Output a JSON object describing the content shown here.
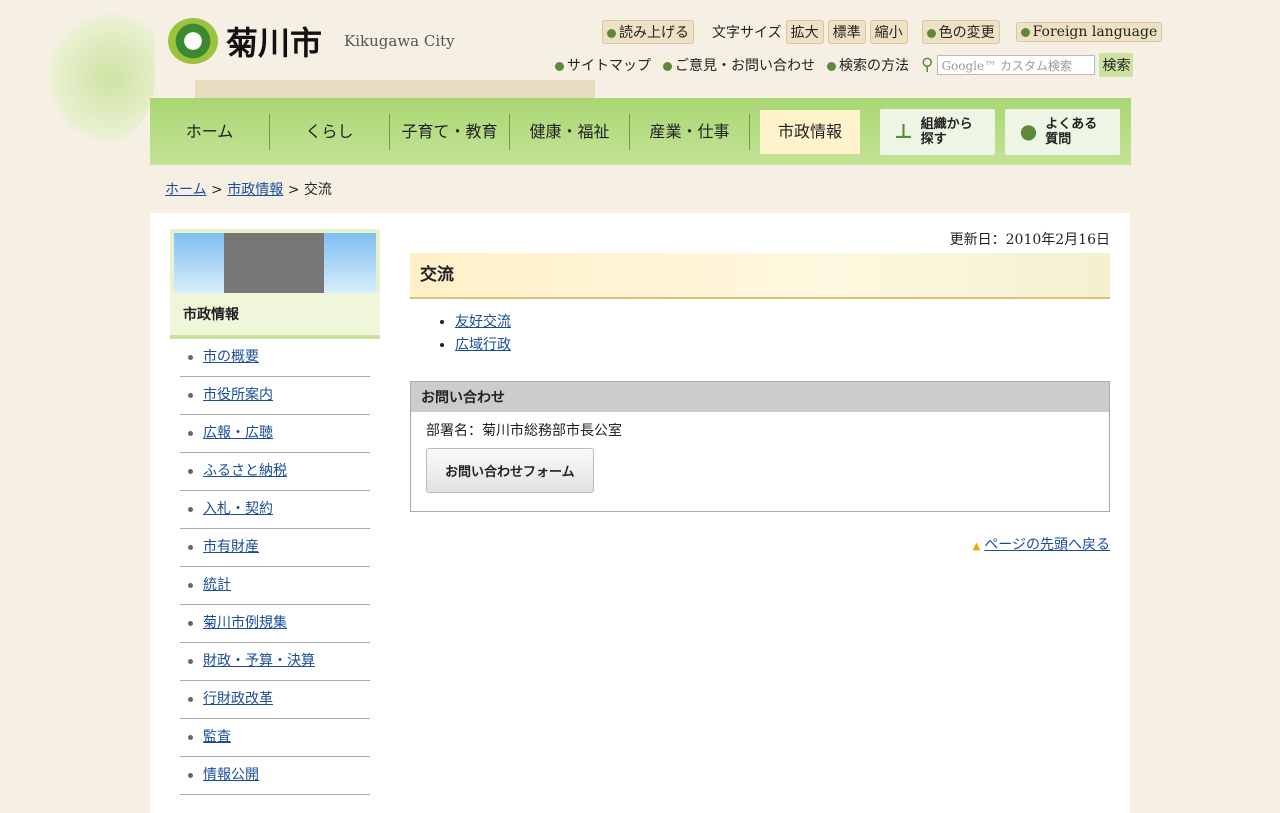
{
  "header": {
    "logo_text": "菊川市",
    "logo_en": "Kikugawa City",
    "read_aloud": "読み上げる",
    "font_size_label": "文字サイズ",
    "font_large": "拡大",
    "font_normal": "標準",
    "font_small": "縮小",
    "color_change": "色の変更",
    "foreign": "Foreign language",
    "sitemap": "サイトマップ",
    "contact": "ご意見・お問い合わせ",
    "search_help": "検索の方法",
    "search_placeholder": "Google™ カスタム検索",
    "search_button": "検索"
  },
  "nav": [
    "ホーム",
    "くらし",
    "子育て・教育",
    "健康・福祉",
    "産業・仕事",
    "市政情報"
  ],
  "nav_buttons": {
    "org": "組織から探す",
    "faq": "よくある質問"
  },
  "breadcrumb": {
    "home": "ホーム",
    "parent": "市政情報",
    "sep": ">",
    "current": "交流"
  },
  "sidebar": {
    "heading": "市政情報",
    "items": [
      "市の概要",
      "市役所案内",
      "広報・広聴",
      "ふるさと納税",
      "入札・契約",
      "市有財産",
      "統計",
      "菊川市例規集",
      "財政・予算・決算",
      "行財政改革",
      "監査",
      "情報公開"
    ]
  },
  "content": {
    "updated": "更新日：2010年2月16日",
    "title": "交流",
    "links": [
      "友好交流",
      "広域行政"
    ],
    "inquiry_title": "お問い合わせ",
    "department": "部署名：菊川市総務部市長公室",
    "form_button": "お問い合わせフォーム",
    "back_to_top": "ページの先頭へ戻る"
  }
}
